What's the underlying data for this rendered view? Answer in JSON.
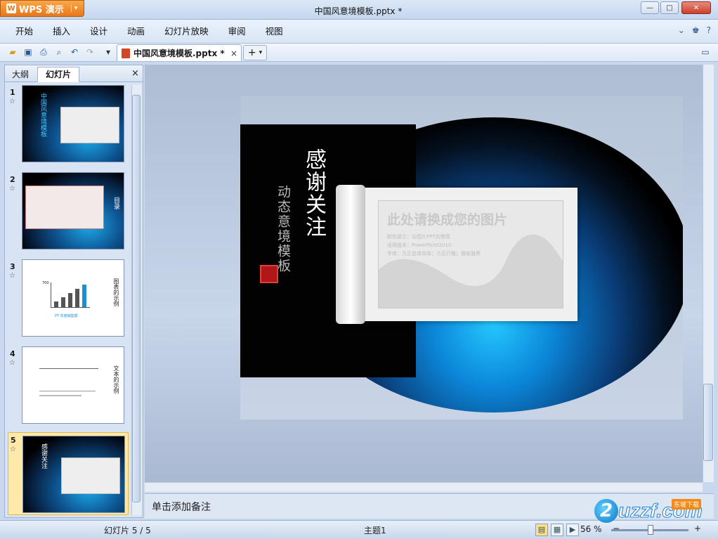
{
  "app": {
    "name": "WPS 演示",
    "logo_letter": "W",
    "menu_arrow": "▾"
  },
  "window": {
    "title": "中国风意境模板.pptx *",
    "minimize": "—",
    "maximize": "□",
    "close": "✕"
  },
  "menu": {
    "items": [
      "开始",
      "插入",
      "设计",
      "动画",
      "幻灯片放映",
      "审阅",
      "视图"
    ]
  },
  "menu_right": {
    "collapse": "⌄",
    "skin": "♚",
    "help": "?"
  },
  "toolbar": {
    "icons": [
      "open-icon",
      "save-icon",
      "print-icon",
      "preview-icon",
      "undo-icon",
      "redo-icon",
      "customize-icon"
    ]
  },
  "tabs": {
    "doc_title": "中国风意境模板.pptx *",
    "close": "×",
    "add": "+",
    "add_arrow": "▾"
  },
  "left_panel": {
    "tab_outline": "大纲",
    "tab_slides": "幻灯片",
    "close": "×"
  },
  "thumbnails": [
    {
      "number": "1",
      "star": "☆",
      "title": "中国风意境模板"
    },
    {
      "number": "2",
      "star": "☆",
      "title": "目录"
    },
    {
      "number": "3",
      "star": "☆",
      "title": "图表的示例",
      "chart_label": "PT 年度销售额",
      "value_label": "700"
    },
    {
      "number": "4",
      "star": "☆",
      "title": "文本的示例"
    },
    {
      "number": "5",
      "star": "☆",
      "title": "感谢关注",
      "selected": true
    }
  ],
  "slide": {
    "title": "感谢关注",
    "subtitle": "动态意境模板",
    "seal": "印",
    "placeholder_title": "此处请换成您的图片",
    "placeholder_lines": [
      "颜色提示：@图片PPT的使用",
      "适用版本：PowerPoint2010",
      "字体：方正启体简体；方正行楷；微软雅黑"
    ]
  },
  "notes": {
    "placeholder": "单击添加备注"
  },
  "statusbar": {
    "slide_info": "幻灯片 5 / 5",
    "theme": "主题1",
    "zoom": "56 %",
    "fit": "⊞",
    "zoom_out": "−",
    "zoom_in": "+"
  },
  "watermark": {
    "logo": "2",
    "text": "uzzf.com",
    "badge": "东坡下载"
  }
}
